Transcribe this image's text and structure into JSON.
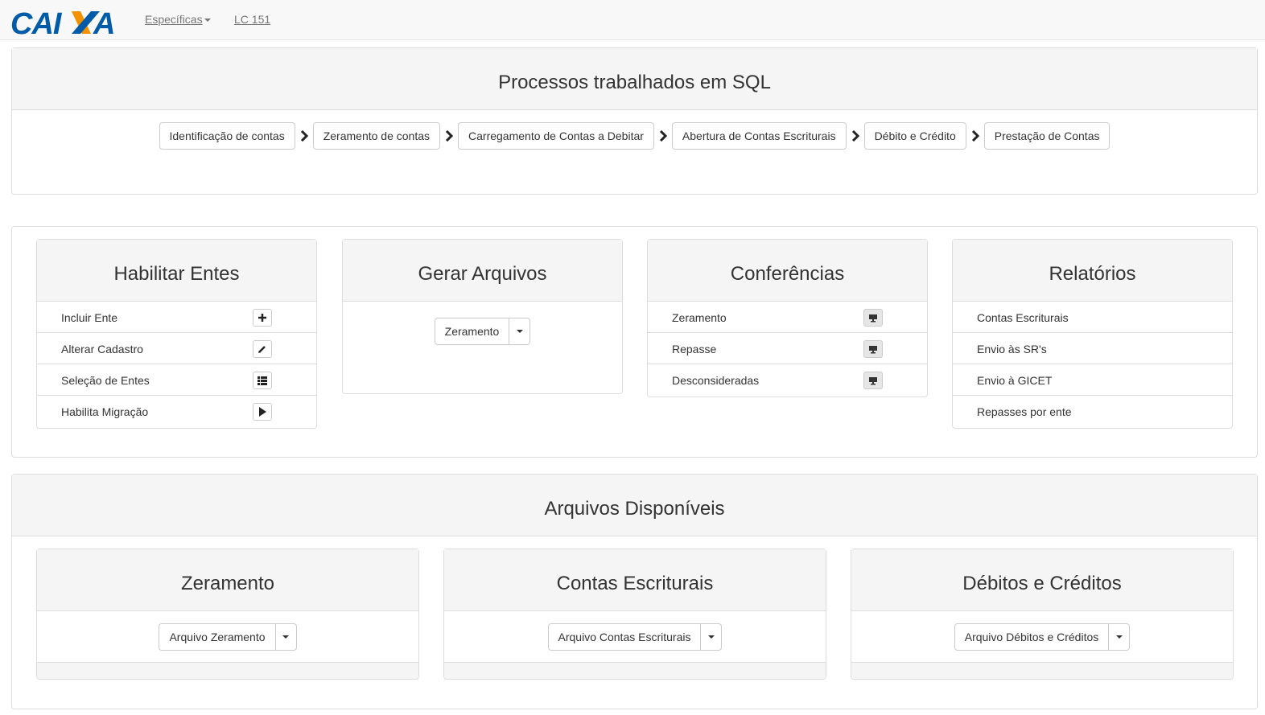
{
  "navbar": {
    "logo_text": "CAIXA",
    "especificas": "Específicas",
    "lc151": "LC 151"
  },
  "process": {
    "title": "Processos trabalhados em SQL",
    "steps": [
      "Identificação de contas",
      "Zeramento de contas",
      "Carregamento de Contas a Debitar",
      "Abertura de Contas Escriturais",
      "Débito e Crédito",
      "Prestação de Contas"
    ]
  },
  "habilitar": {
    "title": "Habilitar Entes",
    "items": [
      {
        "label": "Incluir Ente",
        "icon": "plus-icon"
      },
      {
        "label": "Alterar Cadastro",
        "icon": "pencil-icon"
      },
      {
        "label": "Seleção de Entes",
        "icon": "list-icon"
      },
      {
        "label": "Habilita Migração",
        "icon": "play-icon"
      }
    ]
  },
  "gerar": {
    "title": "Gerar Arquivos",
    "button": "Zeramento"
  },
  "conferencias": {
    "title": "Conferências",
    "items": [
      {
        "label": "Zeramento",
        "icon": "monitor-icon"
      },
      {
        "label": "Repasse",
        "icon": "monitor-icon"
      },
      {
        "label": "Desconsideradas",
        "icon": "monitor-icon"
      }
    ]
  },
  "relatorios": {
    "title": "Relatórios",
    "items": [
      {
        "label": "Contas Escriturais"
      },
      {
        "label": "Envio às SR's"
      },
      {
        "label": "Envio à GICET"
      },
      {
        "label": "Repasses por ente"
      }
    ]
  },
  "arquivos": {
    "title": "Arquivos Disponíveis",
    "panels": [
      {
        "title": "Zeramento",
        "button": "Arquivo Zeramento"
      },
      {
        "title": "Contas Escriturais",
        "button": "Arquivo Contas Escriturais"
      },
      {
        "title": "Débitos e Créditos",
        "button": "Arquivo Débitos e Créditos"
      }
    ]
  },
  "colors": {
    "logo_blue": "#005ca9",
    "logo_orange": "#f39200",
    "panel_heading_bg": "#f5f5f5",
    "border": "#dddddd"
  }
}
